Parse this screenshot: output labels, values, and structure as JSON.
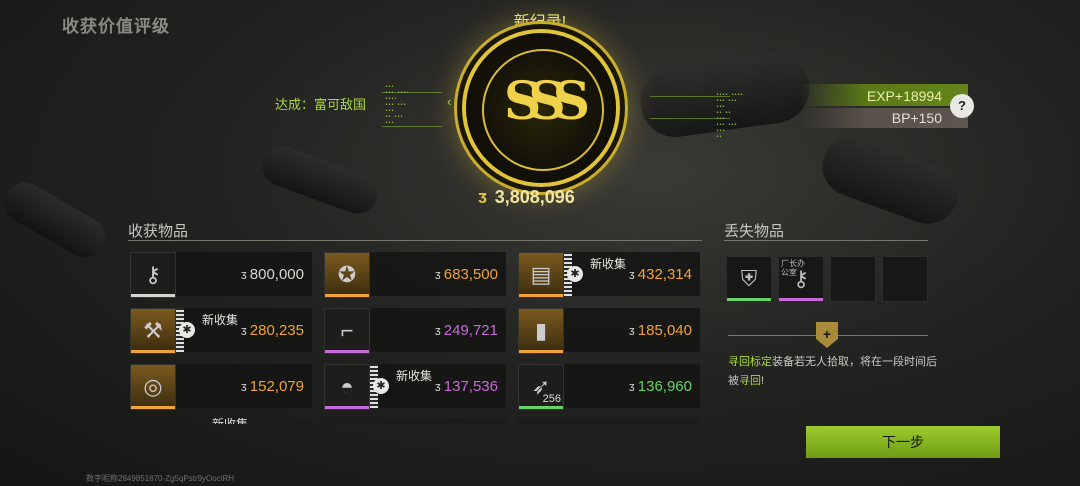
{
  "header": {
    "title": "收获价值评级"
  },
  "result": {
    "record_label": "新纪录!",
    "achievement": "达成：富可敌国",
    "grade": "SSS",
    "total_value": "3,808,096",
    "exp": "EXP+18994",
    "bp": "BP+150",
    "help_icon": "help-icon"
  },
  "collected": {
    "title": "收获物品",
    "items": [
      {
        "icon": "keys-icon",
        "value": "800,000",
        "rarity": "white",
        "new": ""
      },
      {
        "icon": "gold-coin-icon",
        "value": "683,500",
        "rarity": "orange",
        "new": ""
      },
      {
        "icon": "device-icon",
        "value": "432,314",
        "rarity": "orange",
        "new": "新收集"
      },
      {
        "icon": "drill-icon",
        "value": "280,235",
        "rarity": "orange",
        "new": "新收集"
      },
      {
        "icon": "rifle-icon",
        "value": "249,721",
        "rarity": "purple",
        "new": ""
      },
      {
        "icon": "armor-plate-icon",
        "value": "185,040",
        "rarity": "orange",
        "new": ""
      },
      {
        "icon": "watch-icon",
        "value": "152,079",
        "rarity": "orange",
        "new": ""
      },
      {
        "icon": "helmet-icon",
        "value": "137,536",
        "rarity": "purple",
        "new": "新收集"
      },
      {
        "icon": "ammo-icon",
        "value": "136,960",
        "rarity": "green",
        "new": "",
        "count": "256"
      }
    ],
    "partial_row_new": "新收集"
  },
  "lost": {
    "title": "丢失物品",
    "items": [
      {
        "icon": "vest-icon",
        "rarity": "green"
      },
      {
        "icon": "keycard-icon",
        "rarity": "purple",
        "label": "厂长办公室"
      },
      {
        "icon": "",
        "rarity": ""
      },
      {
        "icon": "",
        "rarity": ""
      }
    ],
    "retrieve_hl1": "寻回标定",
    "retrieve_text1": "装备若无人拾取，将在一段时间后被",
    "retrieve_hl2": "寻回",
    "retrieve_text2": "!"
  },
  "actions": {
    "next": "下一步"
  },
  "footer": {
    "uid": "数字昵称2849851870-Zg5qPstr9yOociRH"
  },
  "colors": {
    "white": "#d6d6d0",
    "orange": "#f0a33a",
    "purple": "#c76ad8",
    "green": "#6bd06a",
    "accent": "#a8d940",
    "gold": "#e0c43a"
  }
}
